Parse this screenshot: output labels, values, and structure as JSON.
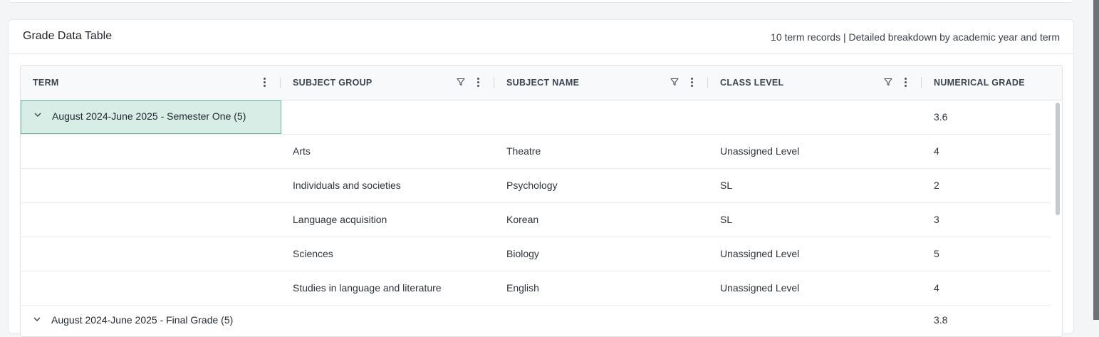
{
  "card": {
    "title": "Grade Data Table",
    "subtitle": "10 term records | Detailed breakdown by academic year and term"
  },
  "columns": [
    {
      "label": "TERM",
      "filter": false
    },
    {
      "label": "SUBJECT GROUP",
      "filter": true
    },
    {
      "label": "SUBJECT NAME",
      "filter": true
    },
    {
      "label": "CLASS LEVEL",
      "filter": true
    },
    {
      "label": "NUMERICAL GRADE",
      "filter": false
    }
  ],
  "groups": [
    {
      "label": "August 2024-June 2025 - Semester One (5)",
      "grade": "3.6",
      "selected": true,
      "rows": [
        {
          "subject_group": "Arts",
          "subject_name": "Theatre",
          "class_level": "Unassigned Level",
          "grade": "4"
        },
        {
          "subject_group": "Individuals and societies",
          "subject_name": "Psychology",
          "class_level": "SL",
          "grade": "2"
        },
        {
          "subject_group": "Language acquisition",
          "subject_name": "Korean",
          "class_level": "SL",
          "grade": "3"
        },
        {
          "subject_group": "Sciences",
          "subject_name": "Biology",
          "class_level": "Unassigned Level",
          "grade": "5"
        },
        {
          "subject_group": "Studies in language and literature",
          "subject_name": "English",
          "class_level": "Unassigned Level",
          "grade": "4"
        }
      ]
    },
    {
      "label": "August 2024-June 2025 - Final Grade (5)",
      "grade": "3.8",
      "selected": false,
      "rows": []
    }
  ],
  "icons": {
    "expand": "chevron-down-icon",
    "filter": "filter-icon",
    "column_menu": "column-menu-icon"
  },
  "colors": {
    "selected_bg": "#d9ede7",
    "selected_border": "#6bb9a0"
  }
}
